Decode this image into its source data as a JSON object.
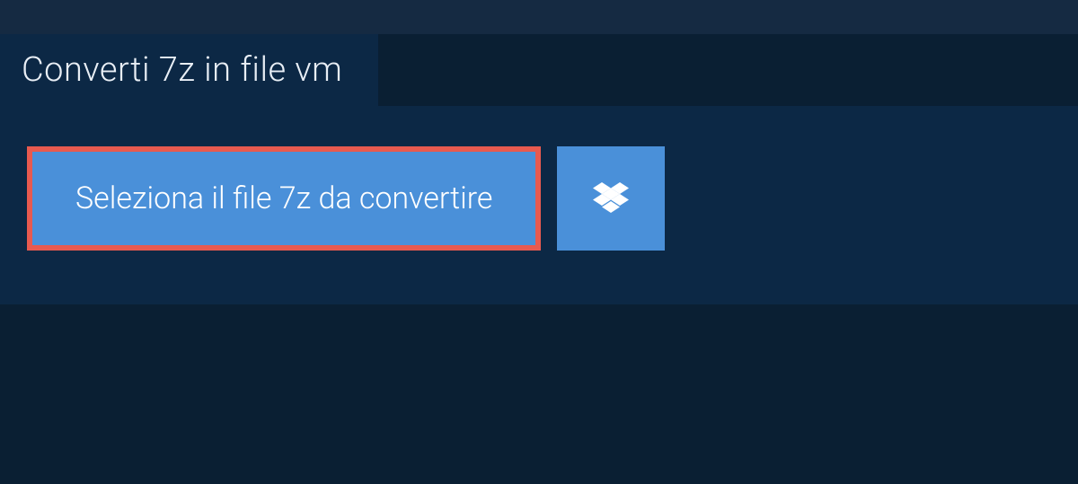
{
  "tab": {
    "title": "Converti 7z in file vm"
  },
  "actions": {
    "select_file_label": "Seleziona il file 7z da convertire"
  },
  "colors": {
    "accent": "#4a90d9",
    "highlight_border": "#e85a4f",
    "panel": "#0c2845",
    "background": "#0a1f33"
  }
}
